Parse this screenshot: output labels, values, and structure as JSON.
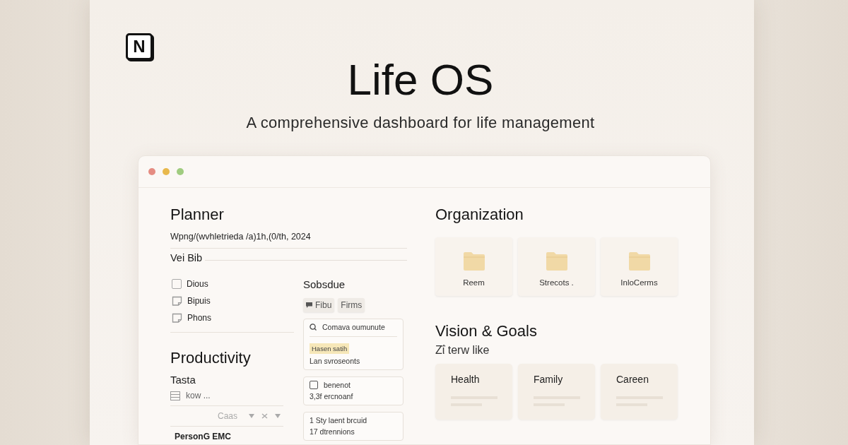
{
  "logo": {
    "letter": "N"
  },
  "title": "Life OS",
  "subtitle": "A comprehensive dashboard for life management",
  "window": {
    "controls": [
      {
        "color": "#e58c82"
      },
      {
        "color": "#e8b84c"
      },
      {
        "color": "#a0cc80"
      }
    ]
  },
  "planner": {
    "heading": "Planner",
    "date": "Wpng/(wvhletrieda /a)1h,(0/th, 2024",
    "section": "Vei Bib",
    "checklist": [
      {
        "label": "Dious",
        "kind": "checkbox",
        "checked": false
      },
      {
        "label": "Bipuis",
        "kind": "note",
        "checked": false
      },
      {
        "label": "Phons",
        "kind": "note",
        "checked": false
      }
    ]
  },
  "productivity": {
    "heading": "Productivity",
    "subheading": "Tasta",
    "rows": [
      {
        "kind": "table",
        "text": "kow ..."
      },
      {
        "kind": "filter",
        "text": "Caas"
      },
      {
        "kind": "text",
        "text": "PersonG EMC"
      }
    ]
  },
  "schedule": {
    "heading": "Sobsdue",
    "chips": [
      {
        "label": "Fibu",
        "kind": "comment"
      },
      {
        "label": "Firms",
        "kind": "plain"
      }
    ],
    "cards": [
      {
        "lines": [
          {
            "kind": "search",
            "text": "Comava oumunute"
          },
          {
            "kind": "tag",
            "text": "Hasen satih"
          },
          {
            "kind": "text",
            "text": "Lan svroseonts"
          }
        ]
      },
      {
        "lines": [
          {
            "kind": "checkbox",
            "text": "benenot",
            "checked": false
          },
          {
            "kind": "text",
            "text": "3,3f ercnoanf"
          }
        ]
      },
      {
        "lines": [
          {
            "kind": "text",
            "text": "1 Sty laent brcuid"
          },
          {
            "kind": "text",
            "text": "17 dtrennions"
          }
        ]
      }
    ]
  },
  "organization": {
    "heading": "Organization",
    "folders": [
      {
        "label": "Reem"
      },
      {
        "label": "Strecots ."
      },
      {
        "label": "InloCerms"
      }
    ]
  },
  "vision": {
    "heading": "Vision & Goals",
    "subtitle": "Zΐ terw like",
    "cards": [
      {
        "label": "Health"
      },
      {
        "label": "Family"
      },
      {
        "label": "Careen"
      }
    ]
  }
}
